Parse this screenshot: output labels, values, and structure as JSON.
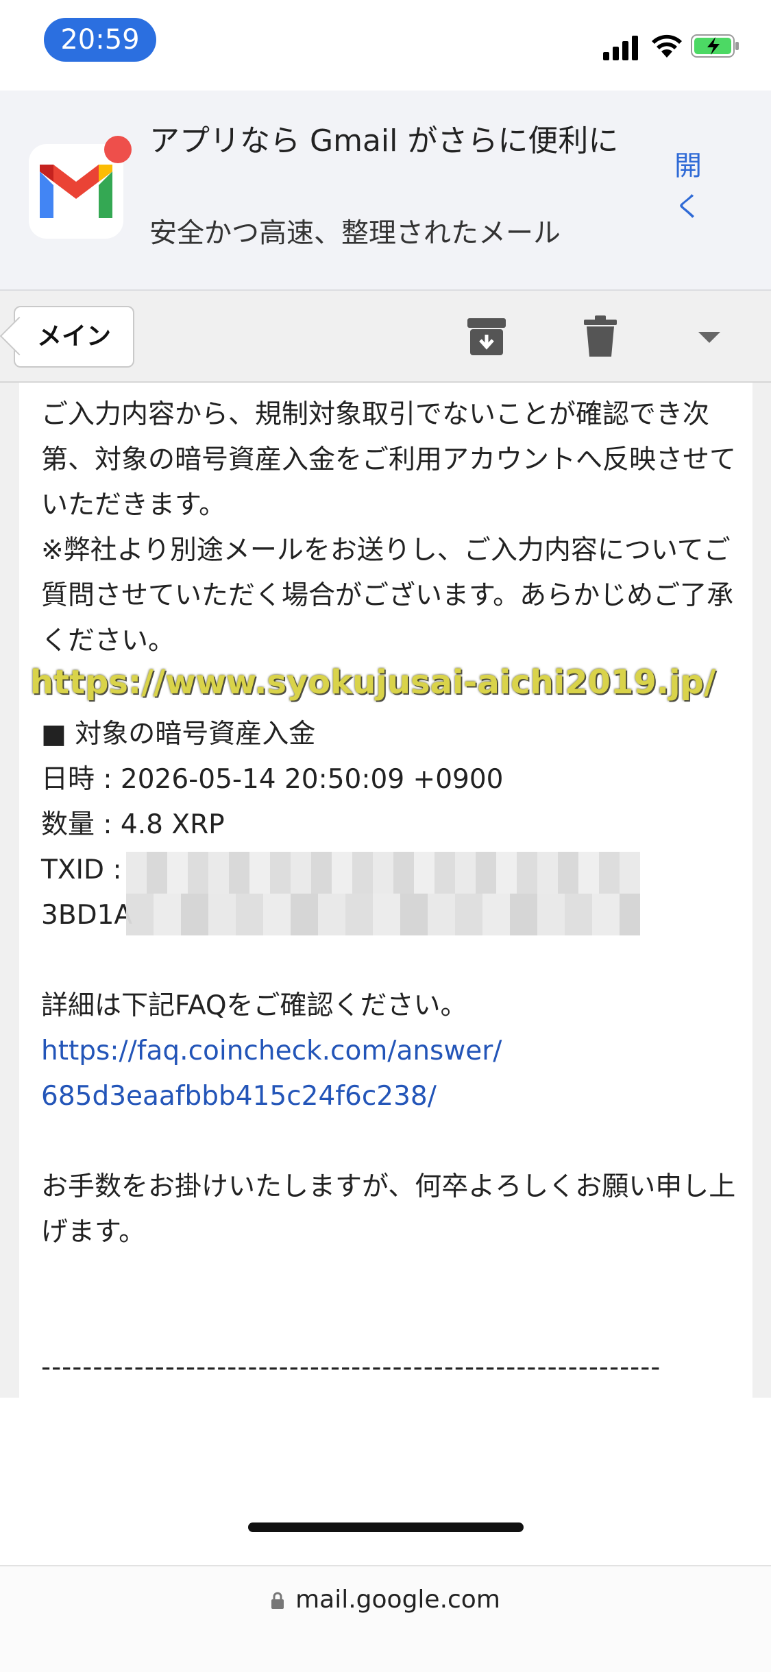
{
  "status_bar": {
    "time": "20:59"
  },
  "app_banner": {
    "title": "アプリなら Gmail がさらに便利に",
    "subtitle": "安全かつ高速、整理されたメール",
    "open_label": "開く"
  },
  "toolbar": {
    "back_label": "メイン",
    "icons": [
      "archive-icon",
      "trash-icon",
      "chevron-down-icon"
    ]
  },
  "email": {
    "paragraph_1": "ご入力内容から、規制対象取引でないことが確認でき次第、対象の暗号資産入金をご利用アカウントへ反映させていただきます。\n※弊社より別途メールをお送りし、ご入力内容についてご質問させていただく場合がございます。あらかじめご了承ください。",
    "watermark": "https://www.syokujusai-aichi2019.jp/",
    "section_heading": "■ 対象の暗号資産入金",
    "datetime_line": "日時 : 2026-05-14 20:50:09 +0900",
    "amount_line": "数量 : 4.8 XRP",
    "txid_label": "TXID :",
    "txid_partial": "3BD1A",
    "faq_intro": "詳細は下記FAQをご確認ください。",
    "faq_link": "https://faq.coincheck.com/answer/\n685d3eaafbbb415c24f6c238/",
    "closing": "お手数をお掛けいたしますが、何卒よろしくお願い申し上げます。",
    "divider": "------------------------------------------------------------"
  },
  "url_bar": {
    "domain": "mail.google.com"
  },
  "colors": {
    "time_pill": "#2b6fe0",
    "link": "#2355b8",
    "banner_bg": "#f2f3f7",
    "watermark": "#d9d34a"
  }
}
